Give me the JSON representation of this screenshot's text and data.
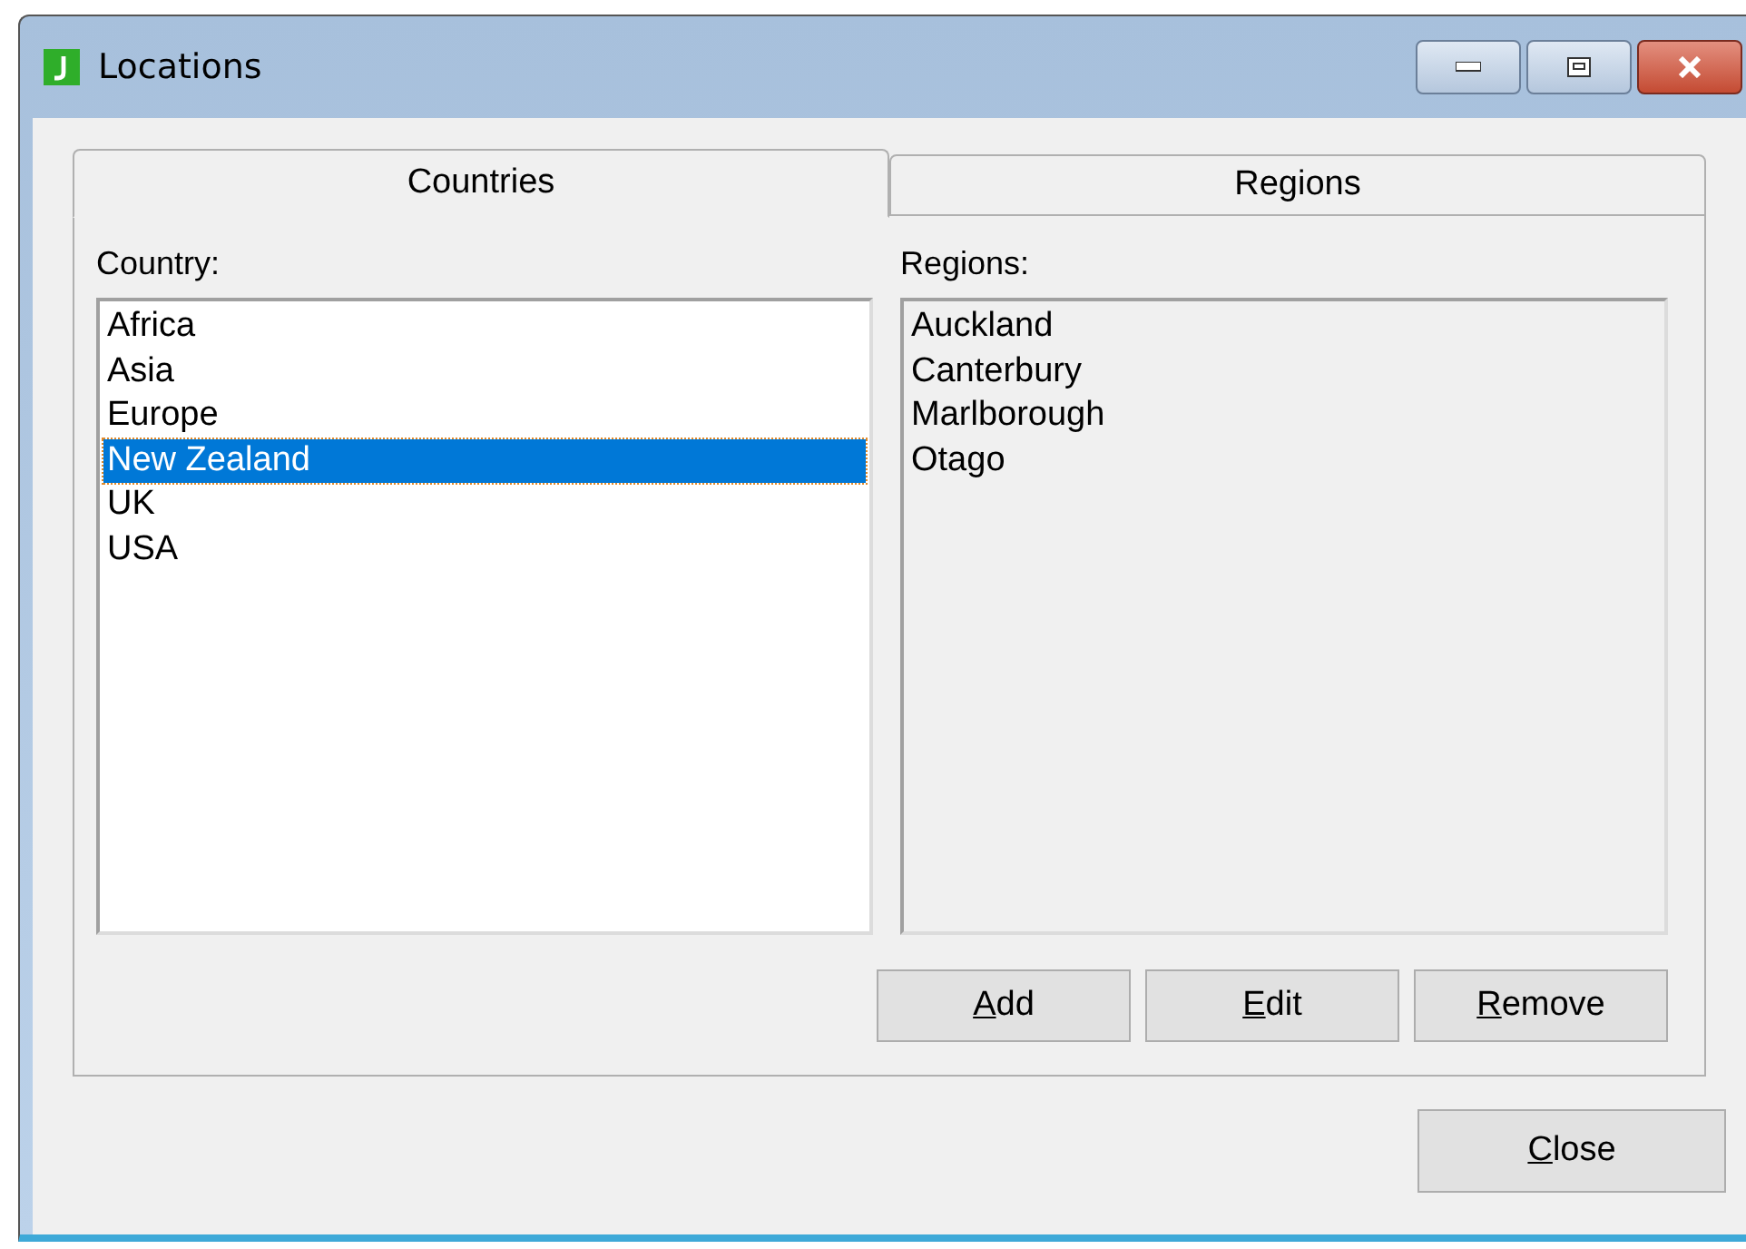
{
  "window": {
    "title": "Locations"
  },
  "tabs": [
    {
      "label": "Countries",
      "selected": true
    },
    {
      "label": "Regions",
      "selected": false
    }
  ],
  "country_list": {
    "label": "Country:",
    "disabled": false,
    "items": [
      {
        "text": "Africa",
        "selected": false
      },
      {
        "text": "Asia",
        "selected": false
      },
      {
        "text": "Europe",
        "selected": false
      },
      {
        "text": "New Zealand",
        "selected": true
      },
      {
        "text": "UK",
        "selected": false
      },
      {
        "text": "USA",
        "selected": false
      }
    ]
  },
  "region_list": {
    "label": "Regions:",
    "disabled": true,
    "items": [
      {
        "text": "Auckland",
        "selected": false
      },
      {
        "text": "Canterbury",
        "selected": false
      },
      {
        "text": "Marlborough",
        "selected": false
      },
      {
        "text": "Otago",
        "selected": false
      }
    ]
  },
  "buttons": [
    {
      "label": "Add",
      "mnemonic_first": true
    },
    {
      "label": "Edit",
      "mnemonic_first": true
    },
    {
      "label": "Remove",
      "mnemonic_first": true
    }
  ],
  "close_button": {
    "label": "Close",
    "mnemonic_first": true
  }
}
